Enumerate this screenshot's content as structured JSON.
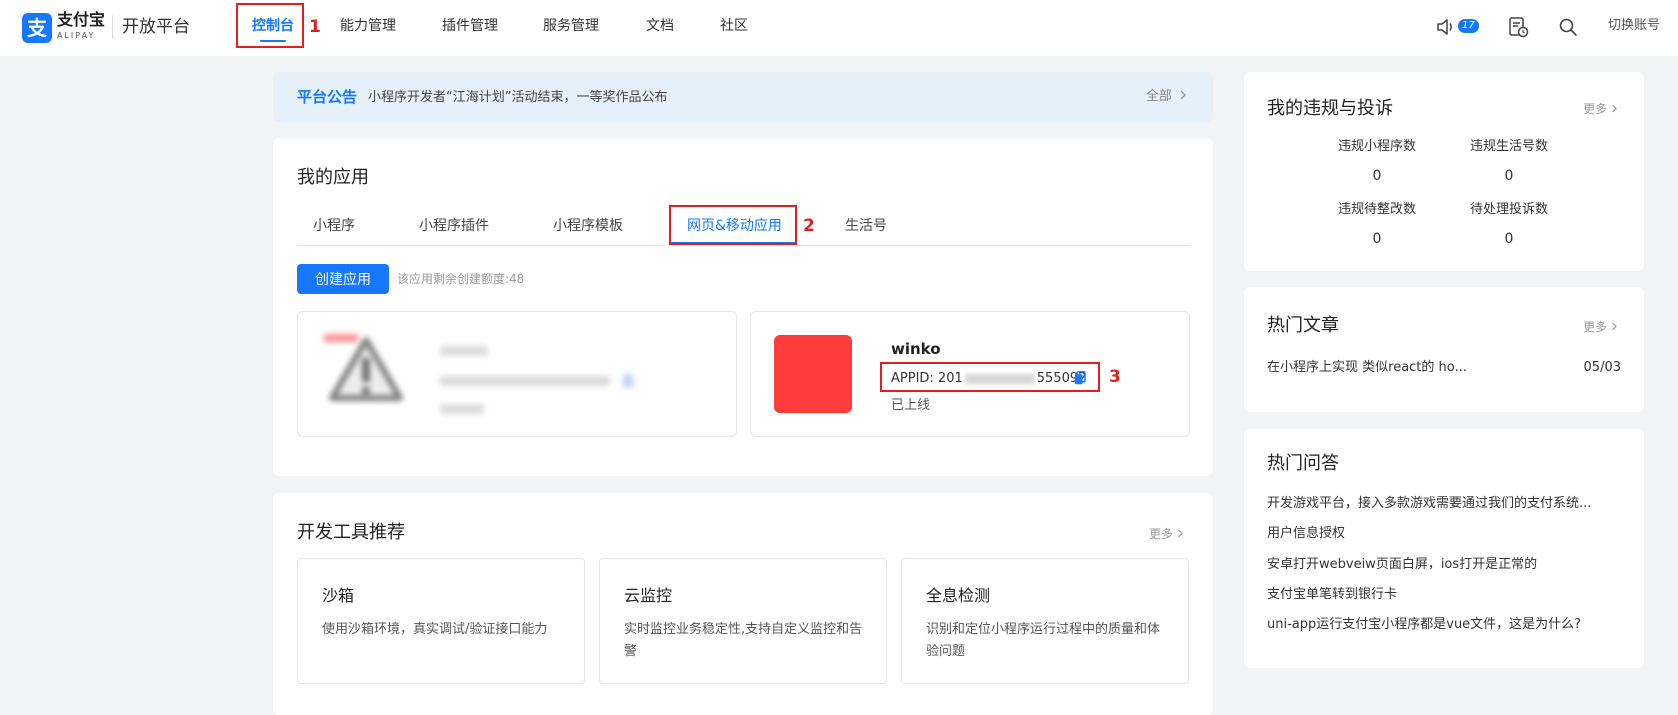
{
  "brand": {
    "mark": "支",
    "name_cn": "支付宝",
    "name_en": "ALIPAY",
    "platform": "开放平台"
  },
  "nav": {
    "items": [
      {
        "label": "控制台"
      },
      {
        "label": "能力管理"
      },
      {
        "label": "插件管理"
      },
      {
        "label": "服务管理"
      },
      {
        "label": "文档"
      },
      {
        "label": "社区"
      }
    ],
    "notification_count": "17",
    "switch_account": "切换账号"
  },
  "annotations": {
    "one": "1",
    "two": "2",
    "three": "3"
  },
  "notice": {
    "title": "平台公告",
    "text": "小程序开发者“江海计划”活动结束，一等奖作品公布",
    "all_label": "全部"
  },
  "my_apps": {
    "title": "我的应用",
    "tabs": [
      {
        "label": "小程序"
      },
      {
        "label": "小程序插件"
      },
      {
        "label": "小程序模板"
      },
      {
        "label": "网页&移动应用"
      },
      {
        "label": "生活号"
      }
    ],
    "active_tab": "网页&移动应用",
    "create_button": "创建应用",
    "quota_text": "该应用剩余创建额度:48",
    "app": {
      "name": "winko",
      "appid_prefix": "APPID: 201",
      "appid_suffix": "555092",
      "status": "已上线"
    }
  },
  "tools": {
    "title": "开发工具推荐",
    "more": "更多",
    "items": [
      {
        "name": "沙箱",
        "desc": "使用沙箱环境，真实调试/验证接口能力"
      },
      {
        "name": "云监控",
        "desc": "实时监控业务稳定性,支持自定义监控和告警"
      },
      {
        "name": "全息检测",
        "desc": "识别和定位小程序运行过程中的质量和体验问题"
      }
    ]
  },
  "violations": {
    "title": "我的违规与投诉",
    "more": "更多",
    "stats": [
      {
        "label": "违规小程序数",
        "value": "0"
      },
      {
        "label": "违规生活号数",
        "value": "0"
      },
      {
        "label": "违规待整改数",
        "value": "0"
      },
      {
        "label": "待处理投诉数",
        "value": "0"
      }
    ]
  },
  "articles": {
    "title": "热门文章",
    "more": "更多",
    "items": [
      {
        "title": "在小程序上实现 类似react的 ho...",
        "date": "05/03"
      }
    ]
  },
  "qa": {
    "title": "热门问答",
    "items": [
      {
        "text": "开发游戏平台，接入多款游戏需要通过我们的支付系统..."
      },
      {
        "text": "用户信息授权"
      },
      {
        "text": "安卓打开webveiw页面白屏，ios打开是正常的"
      },
      {
        "text": "支付宝单笔转到银行卡"
      },
      {
        "text": "uni-app运行支付宝小程序都是vue文件，这是为什么?"
      }
    ]
  }
}
